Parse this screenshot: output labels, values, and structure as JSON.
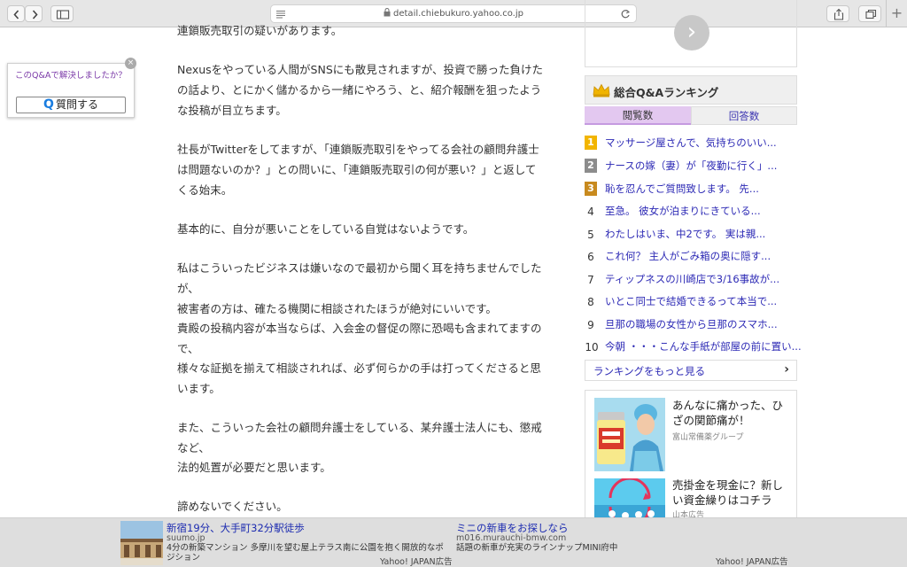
{
  "browser": {
    "url": "detail.chiebukuro.yahoo.co.jp",
    "new_tab": "+"
  },
  "float_widget": {
    "question": "このQ&Aで解決しましたか？",
    "close": "×",
    "button_icon": "Q",
    "button_label": "質問する"
  },
  "article": {
    "lines": [
      "連鎖販売取引の疑いがあります。",
      "Nexusをやっている人間がSNSにも散見されますが、投資で勝った負けた",
      "の話より、とにかく儲かるから一緒にやろう、と、紹介報酬を狙ったよう",
      "な投稿が目立ちます。",
      "社長がTwitterをしてますが、「連鎖販売取引をやってる会社の顧問弁護士",
      "は問題ないのか？」との問いに、「連鎖販売取引の何が悪い？」と返して",
      "くる始末。",
      "基本的に、自分が悪いことをしている自覚はないようです。",
      "私はこういったビジネスは嫌いなので最初から聞く耳を持ちませんでした",
      "が、",
      "被害者の方は、確たる機関に相談されたほうが絶対にいいです。",
      "貴殿の投稿内容が本当ならば、入会金の督促の際に恐喝も含まれてますの",
      "で、",
      "様々な証拠を揃えて相談されれば、必ず何らかの手は打ってくださると思",
      "います。",
      "また、こういった会社の顧問弁護士をしている、某弁護士法人にも、懲戒",
      "など、",
      "法的処置が必要だと思います。",
      "諦めないでください。"
    ]
  },
  "ranking": {
    "next_icon": "›",
    "title": "総合Q&Aランキング",
    "tabs": [
      "閲覧数",
      "回答数"
    ],
    "items": [
      {
        "rank": "1",
        "text": "マッサージ屋さんで、気持ちのいい..."
      },
      {
        "rank": "2",
        "text": "ナースの嫁（妻）が「夜勤に行く」..."
      },
      {
        "rank": "3",
        "text": "恥を忍んでご質問致します。 先..."
      },
      {
        "rank": "4",
        "text": "至急。 彼女が泊まりにきている..."
      },
      {
        "rank": "5",
        "text": "わたしはいま、中2です。 実は親..."
      },
      {
        "rank": "6",
        "text": "これ何？ 主人がごみ箱の奥に隠す..."
      },
      {
        "rank": "7",
        "text": "ティップネスの川崎店で3/16事故が..."
      },
      {
        "rank": "8",
        "text": "いとこ同士で結婚できるって本当で..."
      },
      {
        "rank": "9",
        "text": "旦那の職場の女性から旦那のスマホ..."
      },
      {
        "rank": "10",
        "text": "今朝 ・・・こんな手紙が部屋の前に置い..."
      }
    ],
    "more_label": "ランキングをもっと見る",
    "more_icon": "›",
    "badge_colors": [
      "#f2b500",
      "#8c8c8c",
      "#c88a1e"
    ]
  },
  "side_ads": {
    "ad1": {
      "title": "あんなに痛かった、ひざの関節痛が！",
      "sponsor": "富山常備薬グループ"
    },
    "ad2": {
      "title": "売掛金を現金に？新しい資金繰りはコチラ",
      "sponsor": "山本広告"
    }
  },
  "bottom_ads": {
    "ad1": {
      "title": "新宿19分、大手町32分駅徒歩",
      "domain": "suumo.jp",
      "desc": "4分の新築マンション 多摩川を望む屋上テラス南に公園を抱く開放的なポジション",
      "credit": "Yahoo! JAPAN広告"
    },
    "ad2": {
      "title": "ミニの新車をお探しなら",
      "domain": "m016.murauchi-bmw.com",
      "desc": "話題の新車が充実のラインナップMINI府中",
      "credit": "Yahoo! JAPAN広告"
    }
  }
}
